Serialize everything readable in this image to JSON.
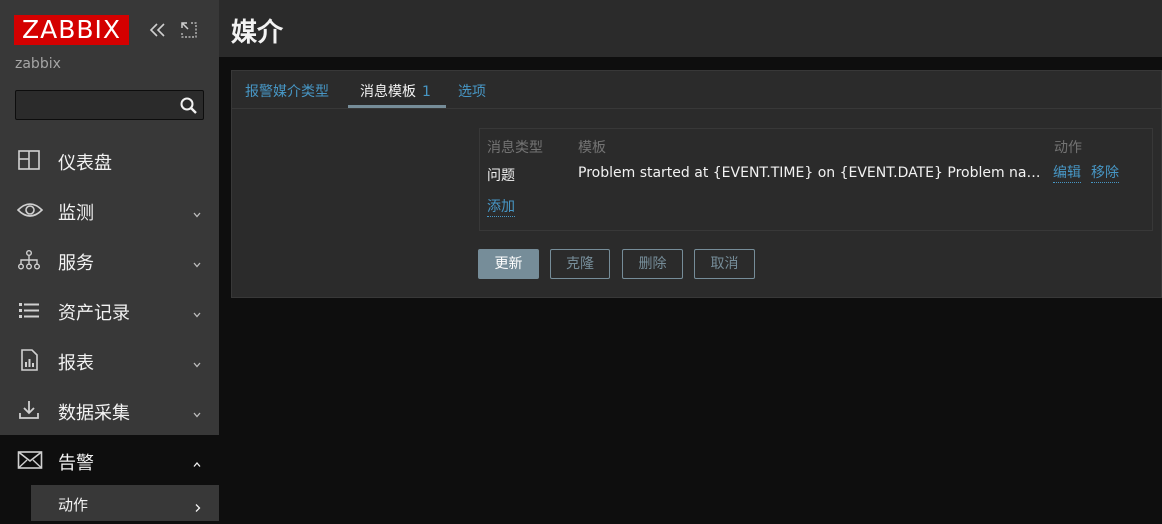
{
  "sidebar": {
    "logo": "ZABBIX",
    "server_name": "zabbix",
    "search": {
      "value": "",
      "placeholder": ""
    },
    "menu": [
      {
        "label": "仪表盘",
        "icon": "dashboard-icon",
        "expanded": false
      },
      {
        "label": "监测",
        "icon": "eye-icon",
        "expanded": false
      },
      {
        "label": "服务",
        "icon": "hierarchy-icon",
        "expanded": false
      },
      {
        "label": "资产记录",
        "icon": "list-icon",
        "expanded": false
      },
      {
        "label": "报表",
        "icon": "report-icon",
        "expanded": false
      },
      {
        "label": "数据采集",
        "icon": "download-icon",
        "expanded": false
      },
      {
        "label": "告警",
        "icon": "envelope-icon",
        "expanded": true
      }
    ],
    "submenu": [
      {
        "label": "动作"
      }
    ]
  },
  "header": {
    "title": "媒介"
  },
  "tabs": [
    {
      "label": "报警媒介类型",
      "selected": false
    },
    {
      "label": "消息模板",
      "count": "1",
      "selected": true
    },
    {
      "label": "选项",
      "selected": false
    }
  ],
  "templates": {
    "columns": [
      "消息类型",
      "模板",
      "动作"
    ],
    "rows": [
      {
        "type": "问题",
        "template": "Problem started at {EVENT.TIME} on {EVENT.DATE} Problem name…",
        "actions": [
          "编辑",
          "移除"
        ]
      }
    ],
    "add_label": "添加"
  },
  "buttons": {
    "update": "更新",
    "clone": "克隆",
    "delete": "删除",
    "cancel": "取消"
  },
  "colors": {
    "accent": "#d40000",
    "link": "#4796c4",
    "button": "#768d99",
    "sidebar_bg": "#383838",
    "panel_bg": "#2b2b2b"
  }
}
